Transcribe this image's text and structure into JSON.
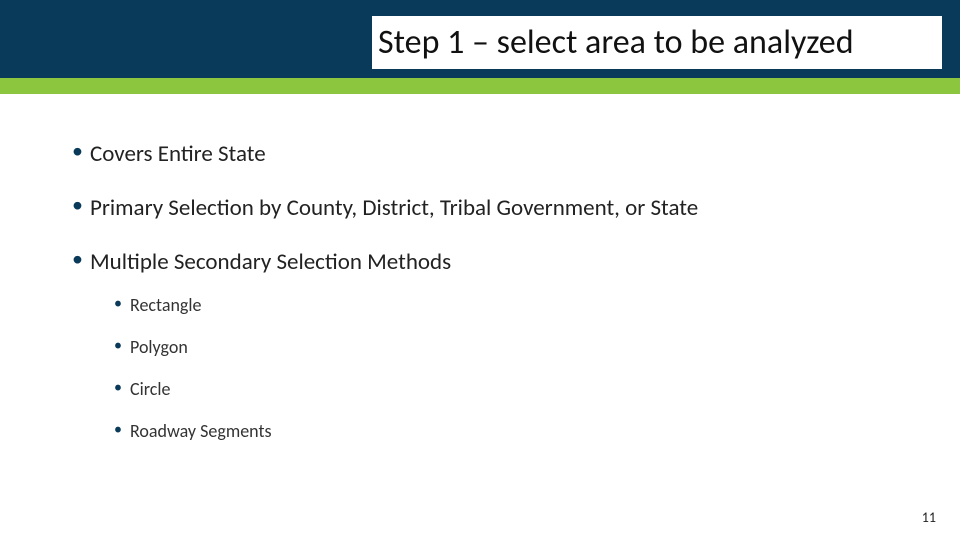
{
  "title": "Step 1 – select area to be analyzed",
  "bullets": {
    "b0": "Covers Entire State",
    "b1": "Primary Selection by County, District,  Tribal Government, or State",
    "b2": "Multiple Secondary Selection Methods",
    "b2_sub": {
      "s0": "Rectangle",
      "s1": "Polygon",
      "s2": "Circle",
      "s3": "Roadway Segments"
    }
  },
  "page_number": "11"
}
